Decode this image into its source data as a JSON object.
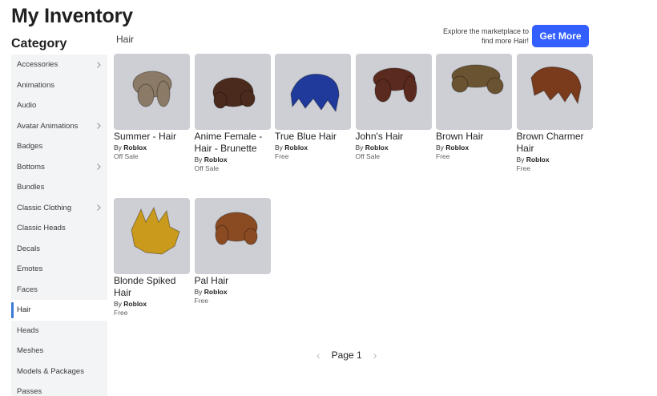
{
  "title": "My Inventory",
  "category_heading": "Category",
  "categories": [
    {
      "label": "Accessories",
      "chevron": true
    },
    {
      "label": "Animations",
      "chevron": false
    },
    {
      "label": "Audio",
      "chevron": false
    },
    {
      "label": "Avatar Animations",
      "chevron": true
    },
    {
      "label": "Badges",
      "chevron": false
    },
    {
      "label": "Bottoms",
      "chevron": true
    },
    {
      "label": "Bundles",
      "chevron": false
    },
    {
      "label": "Classic Clothing",
      "chevron": true
    },
    {
      "label": "Classic Heads",
      "chevron": false
    },
    {
      "label": "Decals",
      "chevron": false
    },
    {
      "label": "Emotes",
      "chevron": false
    },
    {
      "label": "Faces",
      "chevron": false
    },
    {
      "label": "Hair",
      "chevron": false,
      "active": true
    },
    {
      "label": "Heads",
      "chevron": false
    },
    {
      "label": "Meshes",
      "chevron": false
    },
    {
      "label": "Models & Packages",
      "chevron": false
    },
    {
      "label": "Passes",
      "chevron": false
    }
  ],
  "subcategory": "Hair",
  "promo": {
    "line1": "Explore the marketplace to",
    "line2": "find more Hair!",
    "button": "Get More"
  },
  "items": [
    {
      "name": "Summer - Hair",
      "by": "By",
      "creator": "Roblox",
      "price": "Off Sale",
      "color": "#8a7a66"
    },
    {
      "name": "Anime Female - Hair - Brunette",
      "by": "By",
      "creator": "Roblox",
      "price": "Off Sale",
      "color": "#4a2a1c"
    },
    {
      "name": "True Blue Hair",
      "by": "By",
      "creator": "Roblox",
      "price": "Free",
      "color": "#1f3a9a"
    },
    {
      "name": "John's Hair",
      "by": "By",
      "creator": "Roblox",
      "price": "Off Sale",
      "color": "#5a2a1e"
    },
    {
      "name": "Brown Hair",
      "by": "By",
      "creator": "Roblox",
      "price": "Free",
      "color": "#6a5330"
    },
    {
      "name": "Brown Charmer Hair",
      "by": "By",
      "creator": "Roblox",
      "price": "Free",
      "color": "#7a3a1c"
    },
    {
      "name": "Blonde Spiked Hair",
      "by": "By",
      "creator": "Roblox",
      "price": "Free",
      "color": "#c99a1c"
    },
    {
      "name": "Pal Hair",
      "by": "By",
      "creator": "Roblox",
      "price": "Free",
      "color": "#8a4a22"
    }
  ],
  "pager": {
    "label": "Page 1"
  }
}
